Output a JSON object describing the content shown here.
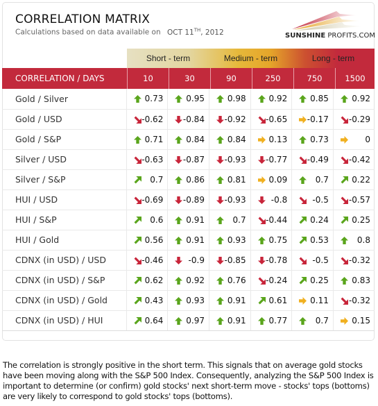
{
  "header": {
    "title": "CORRELATION MATRIX",
    "subtitle": "Calculations based on data available on",
    "date_prefix": "OCT 11",
    "date_sup": "TH",
    "date_suffix": ", 2012",
    "logo_bold": "SUNSHINE",
    "logo_rest": " PROFITS.COM"
  },
  "colors": {
    "accent_red": "#c22a3c",
    "arrow_up_green": "#5aa51c",
    "arrow_flat_orange": "#f0b020",
    "arrow_down_red": "#c8253a"
  },
  "terms": [
    "Short - term",
    "Medium - term",
    "Long - term"
  ],
  "table": {
    "corner_label": "CORRELATION / DAYS",
    "columns": [
      "10",
      "30",
      "90",
      "250",
      "750",
      "1500"
    ],
    "rows": [
      {
        "label": "Gold / Silver",
        "cells": [
          {
            "v": "0.73",
            "a": "up"
          },
          {
            "v": "0.95",
            "a": "up"
          },
          {
            "v": "0.98",
            "a": "up"
          },
          {
            "v": "0.92",
            "a": "up"
          },
          {
            "v": "0.85",
            "a": "up"
          },
          {
            "v": "0.92",
            "a": "up"
          }
        ]
      },
      {
        "label": "Gold / USD",
        "cells": [
          {
            "v": "-0.62",
            "a": "down-right"
          },
          {
            "v": "-0.84",
            "a": "down"
          },
          {
            "v": "-0.92",
            "a": "down"
          },
          {
            "v": "-0.65",
            "a": "down-right"
          },
          {
            "v": "-0.17",
            "a": "right"
          },
          {
            "v": "-0.29",
            "a": "down-right"
          }
        ]
      },
      {
        "label": "Gold / S&P",
        "cells": [
          {
            "v": "0.71",
            "a": "up"
          },
          {
            "v": "0.84",
            "a": "up"
          },
          {
            "v": "0.84",
            "a": "up"
          },
          {
            "v": "0.13",
            "a": "right"
          },
          {
            "v": "0.73",
            "a": "up"
          },
          {
            "v": "0",
            "a": "right"
          }
        ]
      },
      {
        "label": "Silver / USD",
        "cells": [
          {
            "v": "-0.63",
            "a": "down-right"
          },
          {
            "v": "-0.87",
            "a": "down"
          },
          {
            "v": "-0.93",
            "a": "down"
          },
          {
            "v": "-0.77",
            "a": "down"
          },
          {
            "v": "-0.49",
            "a": "down-right"
          },
          {
            "v": "-0.42",
            "a": "down-right"
          }
        ]
      },
      {
        "label": "Silver / S&P",
        "cells": [
          {
            "v": "0.7",
            "a": "up-right"
          },
          {
            "v": "0.86",
            "a": "up"
          },
          {
            "v": "0.81",
            "a": "up"
          },
          {
            "v": "0.09",
            "a": "right"
          },
          {
            "v": "0.7",
            "a": "up"
          },
          {
            "v": "0.22",
            "a": "up-right"
          }
        ]
      },
      {
        "label": "HUI / USD",
        "cells": [
          {
            "v": "-0.69",
            "a": "down-right"
          },
          {
            "v": "-0.89",
            "a": "down"
          },
          {
            "v": "-0.93",
            "a": "down"
          },
          {
            "v": "-0.8",
            "a": "down"
          },
          {
            "v": "-0.5",
            "a": "down-right"
          },
          {
            "v": "-0.57",
            "a": "down-right"
          }
        ]
      },
      {
        "label": "HUI / S&P",
        "cells": [
          {
            "v": "0.6",
            "a": "up-right"
          },
          {
            "v": "0.91",
            "a": "up"
          },
          {
            "v": "0.7",
            "a": "up"
          },
          {
            "v": "-0.44",
            "a": "down-right"
          },
          {
            "v": "0.24",
            "a": "up-right"
          },
          {
            "v": "0.25",
            "a": "up-right"
          }
        ]
      },
      {
        "label": "HUI / Gold",
        "cells": [
          {
            "v": "0.56",
            "a": "up-right"
          },
          {
            "v": "0.91",
            "a": "up"
          },
          {
            "v": "0.93",
            "a": "up"
          },
          {
            "v": "0.75",
            "a": "up"
          },
          {
            "v": "0.53",
            "a": "up-right"
          },
          {
            "v": "0.8",
            "a": "up"
          }
        ]
      },
      {
        "label": "CDNX (in USD) / USD",
        "cells": [
          {
            "v": "-0.46",
            "a": "down-right"
          },
          {
            "v": "-0.9",
            "a": "down"
          },
          {
            "v": "-0.85",
            "a": "down"
          },
          {
            "v": "-0.78",
            "a": "down"
          },
          {
            "v": "-0.5",
            "a": "down-right"
          },
          {
            "v": "-0.32",
            "a": "down-right"
          }
        ]
      },
      {
        "label": "CDNX (in USD) / S&P",
        "cells": [
          {
            "v": "0.62",
            "a": "up-right"
          },
          {
            "v": "0.92",
            "a": "up"
          },
          {
            "v": "0.76",
            "a": "up"
          },
          {
            "v": "-0.24",
            "a": "down-right"
          },
          {
            "v": "0.25",
            "a": "up-right"
          },
          {
            "v": "0.83",
            "a": "up"
          }
        ]
      },
      {
        "label": "CDNX (in USD) / Gold",
        "cells": [
          {
            "v": "0.43",
            "a": "up-right"
          },
          {
            "v": "0.93",
            "a": "up"
          },
          {
            "v": "0.91",
            "a": "up"
          },
          {
            "v": "0.61",
            "a": "up-right"
          },
          {
            "v": "0.11",
            "a": "right"
          },
          {
            "v": "-0.32",
            "a": "down-right"
          }
        ]
      },
      {
        "label": "CDNX (in USD) / HUI",
        "cells": [
          {
            "v": "0.64",
            "a": "up-right"
          },
          {
            "v": "0.97",
            "a": "up"
          },
          {
            "v": "0.91",
            "a": "up"
          },
          {
            "v": "0.77",
            "a": "up"
          },
          {
            "v": "0.7",
            "a": "up"
          },
          {
            "v": "0.15",
            "a": "right"
          }
        ]
      }
    ]
  },
  "footer": {
    "text": "The correlation is strongly positive in the short term. This signals that on average gold stocks have been moving along with the S&P 500 Index. Consequently, analyzing the S&P 500 Index is important to determine (or confirm) gold stocks' next short-term move - stocks' tops (bottoms) are very likely to correspond to gold stocks' tops (bottoms)."
  }
}
